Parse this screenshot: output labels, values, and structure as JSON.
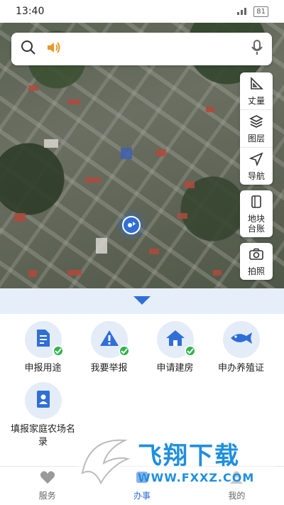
{
  "status_bar": {
    "time": "13:40",
    "battery": "81"
  },
  "search": {
    "placeholder": ""
  },
  "map_tools": [
    {
      "label": "丈量",
      "icon": "ruler-icon"
    },
    {
      "label": "图层",
      "icon": "layers-icon"
    },
    {
      "label": "导航",
      "icon": "navigate-icon"
    },
    {
      "label": "地块\n台账",
      "icon": "ledger-icon"
    },
    {
      "label": "拍照",
      "icon": "camera-icon"
    }
  ],
  "services": [
    {
      "label": "申报用途",
      "icon": "document-icon",
      "checked": true
    },
    {
      "label": "我要举报",
      "icon": "warning-icon",
      "checked": true
    },
    {
      "label": "申请建房",
      "icon": "house-icon",
      "checked": true
    },
    {
      "label": "申办养殖证",
      "icon": "fish-icon",
      "checked": false
    },
    {
      "label": "填报家庭农场名录",
      "icon": "contact-book-icon",
      "checked": false
    }
  ],
  "tabs": [
    {
      "label": "服务",
      "icon": "heart-icon",
      "active": false
    },
    {
      "label": "办事",
      "icon": "tasks-icon",
      "active": true
    },
    {
      "label": "我的",
      "icon": "user-icon",
      "active": false
    }
  ],
  "watermark": {
    "title": "飞翔下载",
    "url": "WWW.FXXZ.COM"
  },
  "colors": {
    "accent": "#2f6fd6",
    "check": "#2fb34a",
    "icon_bg": "#e4ecf8"
  }
}
